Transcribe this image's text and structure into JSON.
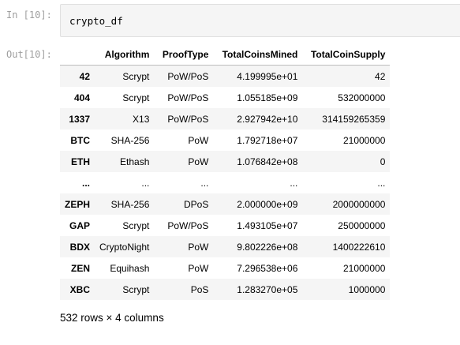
{
  "input_prompt": "In [10]:",
  "code": "crypto_df",
  "output_prompt": "Out[10]:",
  "table": {
    "index_header": "",
    "columns": [
      "Algorithm",
      "ProofType",
      "TotalCoinsMined",
      "TotalCoinSupply"
    ],
    "rows": [
      {
        "index": "42",
        "cells": [
          "Scrypt",
          "PoW/PoS",
          "4.199995e+01",
          "42"
        ]
      },
      {
        "index": "404",
        "cells": [
          "Scrypt",
          "PoW/PoS",
          "1.055185e+09",
          "532000000"
        ]
      },
      {
        "index": "1337",
        "cells": [
          "X13",
          "PoW/PoS",
          "2.927942e+10",
          "314159265359"
        ]
      },
      {
        "index": "BTC",
        "cells": [
          "SHA-256",
          "PoW",
          "1.792718e+07",
          "21000000"
        ]
      },
      {
        "index": "ETH",
        "cells": [
          "Ethash",
          "PoW",
          "1.076842e+08",
          "0"
        ]
      },
      {
        "index": "...",
        "cells": [
          "...",
          "...",
          "...",
          "..."
        ]
      },
      {
        "index": "ZEPH",
        "cells": [
          "SHA-256",
          "DPoS",
          "2.000000e+09",
          "2000000000"
        ]
      },
      {
        "index": "GAP",
        "cells": [
          "Scrypt",
          "PoW/PoS",
          "1.493105e+07",
          "250000000"
        ]
      },
      {
        "index": "BDX",
        "cells": [
          "CryptoNight",
          "PoW",
          "9.802226e+08",
          "1400222610"
        ]
      },
      {
        "index": "ZEN",
        "cells": [
          "Equihash",
          "PoW",
          "7.296538e+06",
          "21000000"
        ]
      },
      {
        "index": "XBC",
        "cells": [
          "Scrypt",
          "PoS",
          "1.283270e+05",
          "1000000"
        ]
      }
    ]
  },
  "summary": "532 rows × 4 columns"
}
